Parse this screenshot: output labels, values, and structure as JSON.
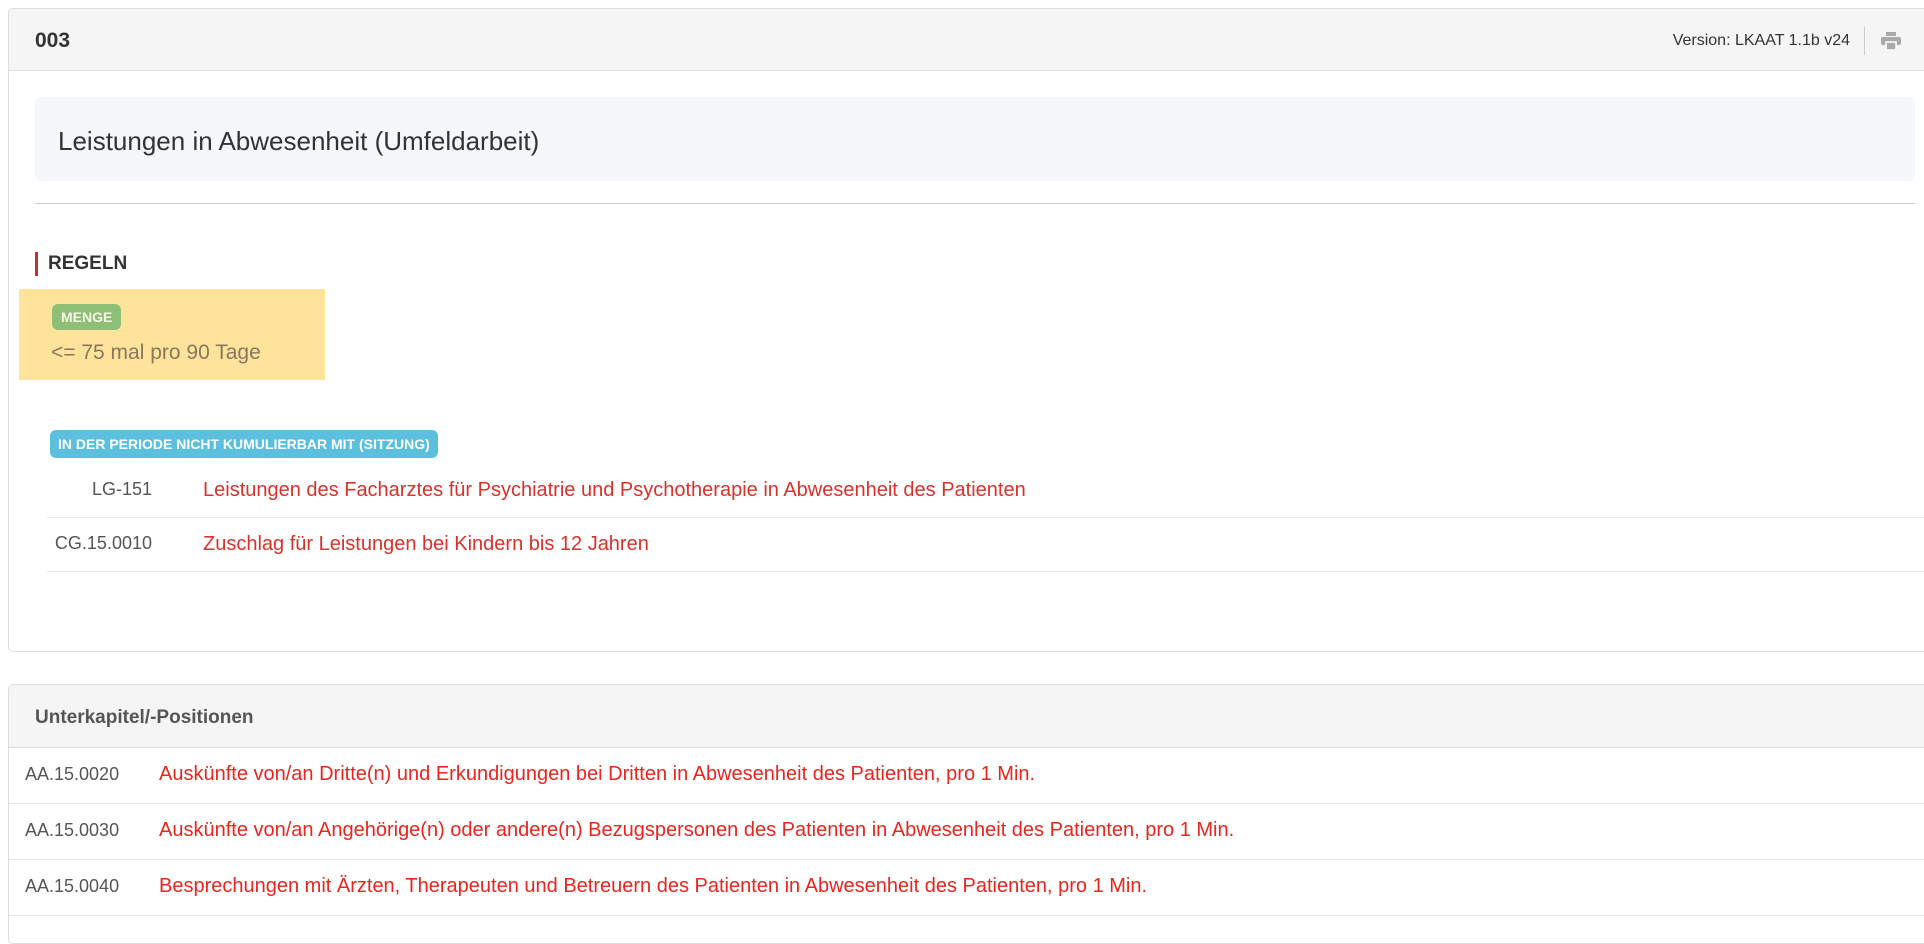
{
  "header": {
    "chapter_code": "003",
    "version": "Version: LKAAT 1.1b v24",
    "print_icon": "printer-icon"
  },
  "chapter": {
    "title": "Leistungen in Abwesenheit (Umfeldarbeit)"
  },
  "regeln": {
    "heading": "REGELN",
    "menge": {
      "badge": "MENGE",
      "rule": "<= 75 mal pro 90 Tage",
      "highlight_color": "#fde49a",
      "badge_color": "#8fbf76"
    },
    "kumulation": {
      "badge": "IN DER PERIODE NICHT KUMULIERBAR MIT (SITZUNG)",
      "badge_color": "#5bc0de",
      "items": [
        {
          "code": "LG-151",
          "text": "Leistungen des Facharztes für Psychiatrie und Psychotherapie in Abwesenheit des Patienten"
        },
        {
          "code": "CG.15.0010",
          "text": "Zuschlag für Leistungen bei Kindern bis 12 Jahren"
        }
      ]
    }
  },
  "unterkapitel": {
    "title": "Unterkapitel/-Positionen",
    "items": [
      {
        "code": "AA.15.0020",
        "text": "Auskünfte von/an Dritte(n) und Erkundigungen bei Dritten in Abwesenheit des Patienten, pro 1 Min."
      },
      {
        "code": "AA.15.0030",
        "text": "Auskünfte von/an Angehörige(n) oder andere(n) Bezugspersonen des Patienten in Abwesenheit des Patienten, pro 1 Min."
      },
      {
        "code": "AA.15.0040",
        "text": "Besprechungen mit Ärzten, Therapeuten und Betreuern des Patienten in Abwesenheit des Patienten, pro 1 Min."
      }
    ]
  },
  "colors": {
    "link_red": "#d9312b",
    "accent_bar": "#c9302c"
  }
}
